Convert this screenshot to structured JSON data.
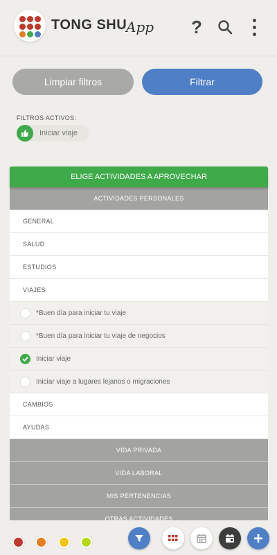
{
  "header": {
    "brand": "TONG SHU",
    "brand_suffix": "App",
    "logo_colors": [
      "#c0392b",
      "#c0392b",
      "#c0392b",
      "#c0392b",
      "#c0392b",
      "#c0392b",
      "#e67e22",
      "#3eaa49",
      "#4f7fc6"
    ],
    "help_label": "?",
    "icons": [
      "help-icon",
      "search-icon",
      "more-vertical-icon"
    ]
  },
  "filters": {
    "clear_label": "Limpiar filtros",
    "apply_label": "Filtrar",
    "active_label": "FILTROS ACTIVOS:",
    "active_chip": "Iniciar viaje"
  },
  "list": {
    "banner": "ELIGE ACTIVIDADES A APROVECHAR",
    "sections": [
      {
        "label": "ACTIVIDADES PERSONALES"
      },
      {
        "label": "VIDA PRIVADA"
      },
      {
        "label": "VIDA LABORAL"
      },
      {
        "label": "MIS PERTENENCIAS"
      },
      {
        "label": "OTRAS ACTIVIDADES"
      }
    ],
    "personal_items": [
      "GENERAL",
      "SALUD",
      "ESTUDIOS",
      "VIAJES",
      "CAMBIOS",
      "AYUDAS"
    ],
    "travel_options": [
      {
        "label": "*Buen día para iniciar tu viaje",
        "checked": false
      },
      {
        "label": "*Buen día para iniciar tu viaje de negocios",
        "checked": false
      },
      {
        "label": "Iniciar viaje",
        "checked": true
      },
      {
        "label": "Iniciar viaje a lugares lejanos o migraciones",
        "checked": false
      }
    ]
  },
  "bottom_bar": {
    "color_dots": [
      "#c0392b",
      "#e67e22",
      "#f1c40f",
      "#b5d916"
    ],
    "buttons": [
      "filter-icon",
      "grid-icon",
      "calendar-icon",
      "calendar-today-icon",
      "plus-icon"
    ],
    "accent": "#4f7fc6"
  }
}
